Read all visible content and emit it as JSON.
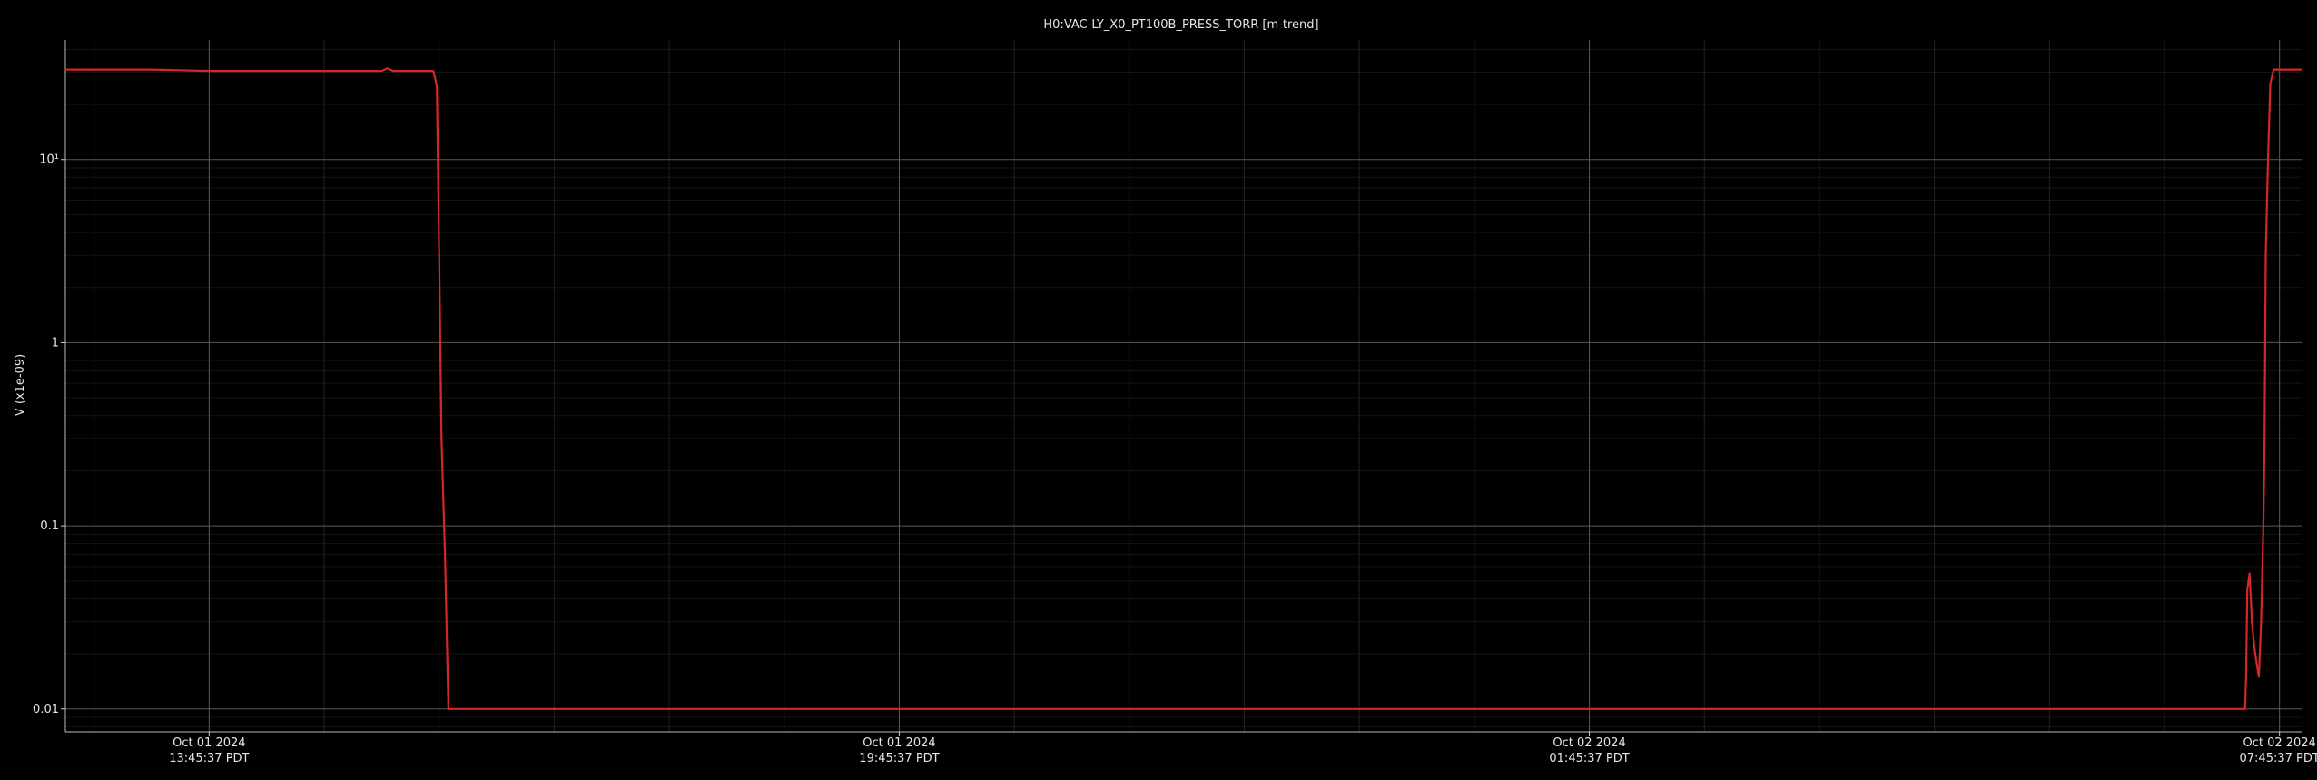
{
  "chart_data": {
    "type": "line",
    "title": "H0:VAC-LY_X0_PT100B_PRESS_TORR [m-trend]",
    "ylabel": "V (x1e-09)",
    "xlabel": "",
    "yscale": "log",
    "ylim": [
      0.0075,
      45
    ],
    "xlim_hours_note": "x values are hours relative to Oct 01 2024 13:45:37 PDT",
    "xlim": [
      -1.25,
      18.2
    ],
    "grid": true,
    "colors": {
      "background": "#000000",
      "series": "#d62728",
      "grid": "#3a3a3a",
      "text": "#e6e6e6"
    },
    "y_ticks": [
      {
        "value": 0.01,
        "label": "0.01"
      },
      {
        "value": 0.1,
        "label": "0.1"
      },
      {
        "value": 1,
        "label": "1"
      },
      {
        "value": 10,
        "label": "10¹"
      }
    ],
    "x_ticks": [
      {
        "value": 0,
        "line1": "Oct 01 2024",
        "line2": "13:45:37 PDT"
      },
      {
        "value": 6,
        "line1": "Oct 01 2024",
        "line2": "19:45:37 PDT"
      },
      {
        "value": 12,
        "line1": "Oct 02 2024",
        "line2": "01:45:37 PDT"
      },
      {
        "value": 18,
        "line1": "Oct 02 2024",
        "line2": "07:45:37 PDT"
      }
    ],
    "series": [
      {
        "x": [
          -1.25,
          -0.5,
          0,
          0.5,
          1.0,
          1.2,
          1.5,
          1.55,
          1.6,
          1.8,
          1.95,
          1.98,
          2.0,
          2.02,
          2.05,
          2.08,
          2.1,
          2.12,
          10.0,
          17.7,
          17.71,
          17.72,
          17.74,
          17.76,
          17.78,
          17.8,
          17.82,
          17.84,
          17.86,
          17.87,
          17.88,
          17.9,
          17.92,
          17.95,
          18.0,
          18.1,
          18.2
        ],
        "y": [
          31,
          31,
          30.5,
          30.5,
          30.5,
          30.5,
          30.5,
          31.5,
          30.5,
          30.5,
          30.5,
          25,
          3,
          0.3,
          0.07,
          0.01,
          0.01,
          0.01,
          0.01,
          0.01,
          0.015,
          0.045,
          0.055,
          0.03,
          0.022,
          0.018,
          0.015,
          0.03,
          0.1,
          0.3,
          3,
          10,
          26,
          31,
          31,
          31,
          31
        ]
      }
    ]
  }
}
